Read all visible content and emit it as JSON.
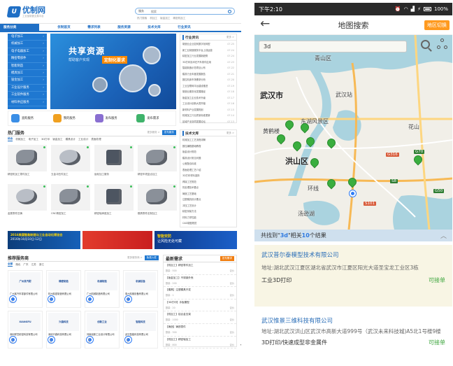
{
  "web": {
    "logo": {
      "mark": "U",
      "name": "优制网",
      "slogan": "工业品制造交易平台"
    },
    "search": {
      "category": "服务",
      "placeholder": "搜索",
      "hot": [
        "热门搜索",
        "机加工",
        "钣金加工",
        "精密机加工"
      ]
    },
    "nav": {
      "category_head": "服务分类",
      "items": [
        "优制首页",
        "需求列表",
        "服务资源",
        "技术文库",
        "行业资讯"
      ]
    },
    "sidebar": [
      "电子加工",
      "机械加工",
      "电子电器加工",
      "精密零部件",
      "智能制造",
      "模具加工",
      "钣金加工",
      "工业设计服务",
      "工业软件服务",
      "材料供应服务"
    ],
    "banner": {
      "title": "共享资源",
      "subtitle": "帮助客户实现",
      "highlight": "定制化要求"
    },
    "news": {
      "title": "行业资讯",
      "more": "更多 >",
      "items": [
        {
          "t": "制造业企业如何数字化转型",
          "d": "07-25"
        },
        {
          "t": "新工业制造服务平台上线运营",
          "d": "07-24"
        },
        {
          "t": "精密加工行业发展新趋势",
          "d": "07-24"
        },
        {
          "t": "3D打印技术在汽车零件应用",
          "d": "07-23"
        },
        {
          "t": "智能制造示范项目公布",
          "d": "07-22"
        },
        {
          "t": "模具行业年度发展报告",
          "d": "07-21"
        },
        {
          "t": "数控机床市场需求分析",
          "d": "07-20"
        },
        {
          "t": "工业互联网平台建设推进",
          "d": "07-19"
        },
        {
          "t": "制造业服务化发展路径",
          "d": "07-18"
        },
        {
          "t": "钣金加工企业技术升级",
          "d": "07-17"
        },
        {
          "t": "工业设计创新大赛开幕",
          "d": "07-16"
        },
        {
          "t": "新材料产业发展规划",
          "d": "07-15"
        },
        {
          "t": "机械加工行业质量标准更新",
          "d": "07-14"
        },
        {
          "t": "区域产业协同发展论坛",
          "d": "07-13"
        }
      ]
    },
    "services": [
      "直购服务",
      "我的服务",
      "发布服务",
      "发布需求"
    ],
    "hot_services": {
      "title": "热门服务",
      "more": "更多服务 >",
      "btn": "发布服务",
      "tabs": [
        "综合",
        "机械加工",
        "电子加工",
        "3D打印",
        "钣金加工",
        "模具设计",
        "工业设计",
        "表面处理"
      ],
      "items": [
        "精密机加工零件加工",
        "五金冲压件加工",
        "齿轮加工服务",
        "精密车铣复合加工",
        "金属零件压铸",
        "CNC精密加工",
        "精密轴承座加工",
        "模具零件定制加工"
      ]
    },
    "tech": {
      "title": "技术文库",
      "more": "更多 >",
      "items": [
        "机械加工工艺流程详解",
        "数控编程基础教程",
        "钣金设计规范",
        "模具设计常见问题",
        "公差配合标准",
        "表面处理工艺介绍",
        "3D打印材料选择",
        "焊接工艺规范",
        "热处理技术要点",
        "铸造工艺基础",
        "注塑模具设计要点",
        "冲压工艺设计",
        "精密测量方法",
        "材料力学性能",
        "CAD制图规范"
      ]
    },
    "ads": {
      "a1": "2016美国智能制造与工业自动化博览会",
      "a1b": "2016年10月10日-12日",
      "a3": "智能安防",
      "a3b": "让风险无处可藏"
    },
    "mfg": {
      "title": "推荐服务商",
      "more": "更多服务商 >",
      "btn": "免费入驻",
      "tabs": [
        "全部",
        "湖北",
        "广东",
        "江苏",
        "浙江"
      ],
      "items": [
        {
          "logo": "广州某汽配",
          "name": "广州某汽车零部件有限公司",
          "loc": "广州"
        },
        {
          "logo": "精密制造",
          "name": "杭州精密制造有限公司",
          "loc": "杭州"
        },
        {
          "logo": "机械制造",
          "name": "广州机械制造有限公司",
          "loc": "广州"
        },
        {
          "logo": "机械设备",
          "name": "惠州机械设备有限公司",
          "loc": "惠州"
        },
        {
          "logo": "XIANGFU",
          "name": "深圳祥富精密科技有限公司",
          "loc": "深圳"
        },
        {
          "logo": "兴森科技",
          "name": "深圳兴森科技有限公司",
          "loc": "深圳"
        },
        {
          "logo": "创新工业",
          "name": "河南创新工业设计有限公司",
          "loc": "郑州"
        },
        {
          "logo": "智能科技",
          "name": "武汉智能科技有限公司",
          "loc": "武汉"
        }
      ]
    },
    "req": {
      "title": "最新需求",
      "btn": "发布需求",
      "items": [
        {
          "t": "【机加工】精密零件加工",
          "q": "数量：500",
          "p": "议价"
        },
        {
          "t": "【钣金加工】不锈钢外壳",
          "q": "数量：200",
          "p": "议价"
        },
        {
          "t": "【模具】注塑模具开发",
          "q": "数量：1",
          "p": "议价"
        },
        {
          "t": "【3D打印】手板模型",
          "q": "数量：20",
          "p": "议价"
        },
        {
          "t": "【机加工】铝合金支架",
          "q": "数量：1000",
          "p": "议价"
        },
        {
          "t": "【铸造】铸铁零件",
          "q": "数量：300",
          "p": "议价"
        },
        {
          "t": "【机加工】精密轴加工",
          "q": "数量：800",
          "p": "议价"
        }
      ]
    }
  },
  "phone": {
    "status": {
      "time": "下午2:10",
      "battery": "100%"
    },
    "appbar": {
      "title": "地图搜索",
      "switch": "地区切换"
    },
    "search_value": "3d",
    "map_labels": {
      "city": "武汉市",
      "a": "青山区",
      "b": "东湖风景区",
      "c": "洪山区",
      "d": "黄鹤楼",
      "e": "武汉站",
      "f": "环线",
      "g": "汤逊湖",
      "h": "花山"
    },
    "roads": [
      "G316",
      "G70",
      "S8",
      "G50",
      "S101"
    ],
    "result": {
      "prefix": "共找到",
      "keyword": "3d",
      "mid": "相关",
      "count": "10",
      "suffix": "个结果"
    },
    "cards": [
      {
        "name": "武汉普尔泰模型技术有限公司",
        "addr": "地址:湖北武汉江夏区湖北省武汉市江夏区阳光大道圣宝龙工业区3栋",
        "type": "工业3D打印",
        "status": "可接单"
      },
      {
        "name": "武汉惟景三维科技有限公司",
        "addr": "地址:湖北武汉洪山区武汉市高新大道999号（武汉未来科技城)A5北1号楼9楼",
        "type": "3D打印/快速成型非金属件",
        "status": "可接单"
      }
    ]
  }
}
